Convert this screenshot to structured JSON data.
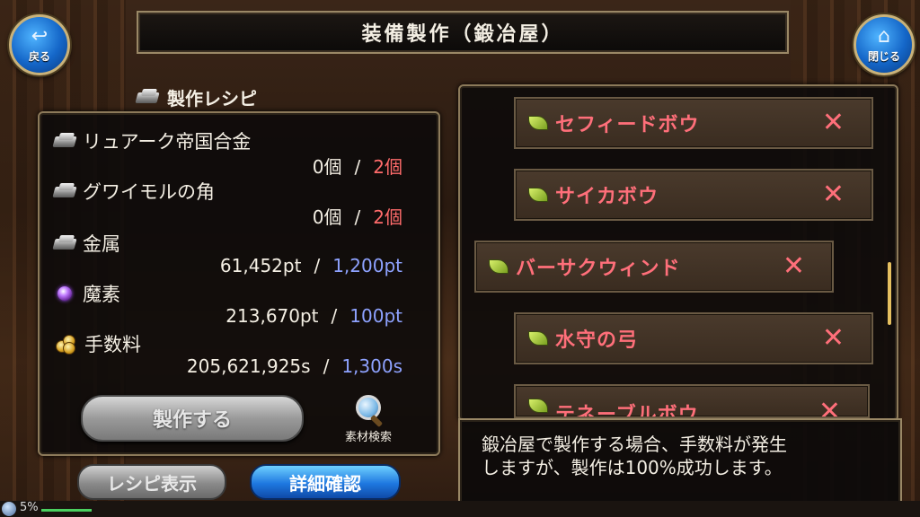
{
  "header": {
    "title": "装備製作（鍛冶屋）",
    "back_label": "戻る",
    "close_label": "閉じる"
  },
  "recipe": {
    "title": "製作レシピ",
    "materials": [
      {
        "name": "リュアーク帝国合金",
        "icon": "ingot-icon",
        "have": "0個",
        "need": "2個",
        "need_color": "#ff6b6b"
      },
      {
        "name": "グワイモルの角",
        "icon": "ingot-icon",
        "have": "0個",
        "need": "2個",
        "need_color": "#ff6b6b"
      },
      {
        "name": "金属",
        "icon": "ingot-icon",
        "have": "61,452pt",
        "need": "1,200pt",
        "need_color": "#8ea2ff"
      },
      {
        "name": "魔素",
        "icon": "magic-orb-icon",
        "have": "213,670pt",
        "need": "100pt",
        "need_color": "#8ea2ff"
      },
      {
        "name": "手数料",
        "icon": "coins-icon",
        "have": "205,621,925s",
        "need": "1,300s",
        "need_color": "#8ea2ff"
      }
    ],
    "separator": "/",
    "make_button": "製作する",
    "search_label": "素材検索"
  },
  "bottom_buttons": {
    "recipe_view": "レシピ表示",
    "details": "詳細確認"
  },
  "item_list": [
    {
      "name": "セフィードボウ",
      "mark": "✕"
    },
    {
      "name": "サイカボウ",
      "mark": "✕"
    },
    {
      "name": "バーサクウィンド",
      "mark": "✕",
      "selected": true
    },
    {
      "name": "水守の弓",
      "mark": "✕"
    },
    {
      "name": "テネーブルボウ",
      "mark": "✕"
    }
  ],
  "description": {
    "line1": "鍛冶屋で製作する場合、手数料が発生",
    "line2": "しますが、製作は100%成功します。"
  },
  "status": {
    "battery": "5%"
  }
}
